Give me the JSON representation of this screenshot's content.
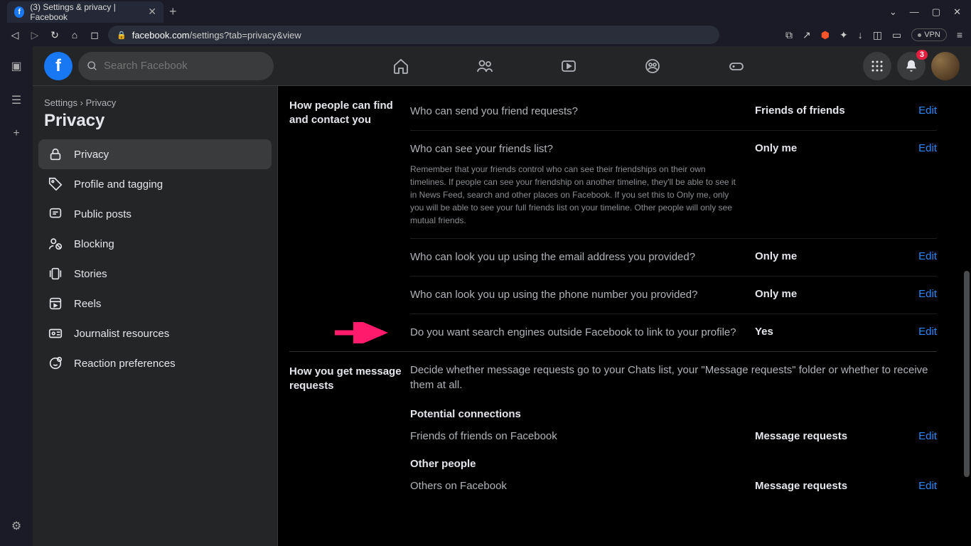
{
  "browser": {
    "tab_title": "(3) Settings & privacy | Facebook",
    "url_domain": "facebook.com",
    "url_path": "/settings?tab=privacy&view",
    "vpn_label": "VPN"
  },
  "header": {
    "search_placeholder": "Search Facebook",
    "notification_count": "3"
  },
  "sidebar": {
    "breadcrumb_root": "Settings",
    "breadcrumb_sep": "›",
    "breadcrumb_leaf": "Privacy",
    "title": "Privacy",
    "items": [
      {
        "label": "Privacy"
      },
      {
        "label": "Profile and tagging"
      },
      {
        "label": "Public posts"
      },
      {
        "label": "Blocking"
      },
      {
        "label": "Stories"
      },
      {
        "label": "Reels"
      },
      {
        "label": "Journalist resources"
      },
      {
        "label": "Reaction preferences"
      }
    ]
  },
  "main": {
    "section1_label": "How people can find and contact you",
    "rows": [
      {
        "q": "Who can send you friend requests?",
        "v": "Friends of friends",
        "edit": "Edit"
      },
      {
        "q": "Who can see your friends list?",
        "sub": "Remember that your friends control who can see their friendships on their own timelines. If people can see your friendship on another timeline, they'll be able to see it in News Feed, search and other places on Facebook. If you set this to Only me, only you will be able to see your full friends list on your timeline. Other people will only see mutual friends.",
        "v": "Only me",
        "edit": "Edit"
      },
      {
        "q": "Who can look you up using the email address you provided?",
        "v": "Only me",
        "edit": "Edit"
      },
      {
        "q": "Who can look you up using the phone number you provided?",
        "v": "Only me",
        "edit": "Edit"
      },
      {
        "q": "Do you want search engines outside Facebook to link to your profile?",
        "v": "Yes",
        "edit": "Edit"
      }
    ],
    "section2_label": "How you get message requests",
    "msg_intro": "Decide whether message requests go to your Chats list, your \"Message requests\" folder or whether to receive them at all.",
    "msg_sub1": "Potential connections",
    "msg_rows1": [
      {
        "q": "Friends of friends on Facebook",
        "v": "Message requests",
        "edit": "Edit"
      }
    ],
    "msg_sub2": "Other people",
    "msg_rows2": [
      {
        "q": "Others on Facebook",
        "v": "Message requests",
        "edit": "Edit"
      }
    ]
  }
}
